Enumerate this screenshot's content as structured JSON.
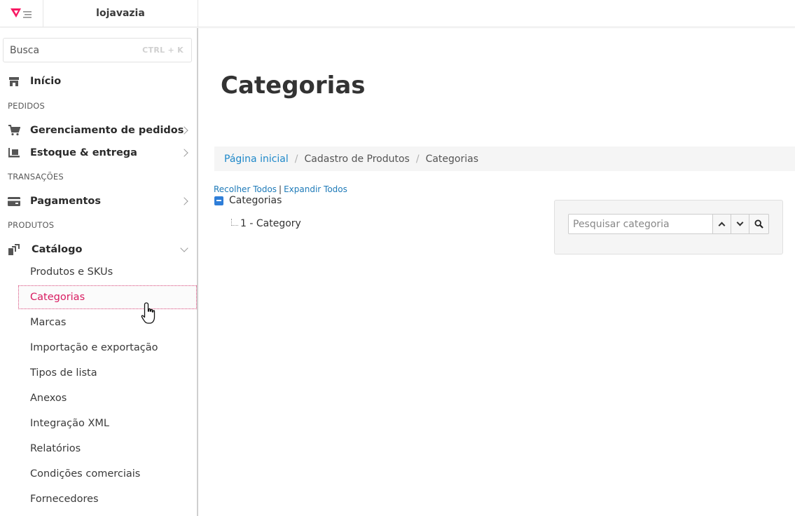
{
  "topbar": {
    "store_name": "lojavazia",
    "logo_icon": "vtex-logo-icon",
    "brand_color": "#f71963"
  },
  "sidebar": {
    "search": {
      "placeholder": "Busca",
      "shortcut": "CTRL + K"
    },
    "home": {
      "label": "Início",
      "icon": "store-icon"
    },
    "sections": {
      "orders": "PEDIDOS",
      "transactions": "TRANSAÇÕES",
      "products": "PRODUTOS"
    },
    "items": [
      {
        "label": "Gerenciamento de pedidos",
        "icon": "cart-icon"
      },
      {
        "label": "Estoque & entrega",
        "icon": "dolly-icon"
      },
      {
        "label": "Pagamentos",
        "icon": "credit-card-icon"
      },
      {
        "label": "Catálogo",
        "icon": "catalog-icon"
      }
    ],
    "catalog_subitems": [
      "Produtos e SKUs",
      "Categorias",
      "Marcas",
      "Importação e exportação",
      "Tipos de lista",
      "Anexos",
      "Integração XML",
      "Relatórios",
      "Condições comerciais",
      "Fornecedores"
    ],
    "active_subitem": "Categorias",
    "active_color": "#d81b60"
  },
  "main": {
    "title": "Categorias",
    "breadcrumb": {
      "home": "Página inicial",
      "level1": "Cadastro de Produtos",
      "current": "Categorias"
    },
    "tree": {
      "collapse_all": "Recolher Todos",
      "expand_all": "Expandir Todos",
      "separator": "|",
      "root": "Categorias",
      "children": [
        "1 - Category"
      ]
    },
    "category_search": {
      "placeholder": "Pesquisar categoria",
      "value": ""
    }
  }
}
